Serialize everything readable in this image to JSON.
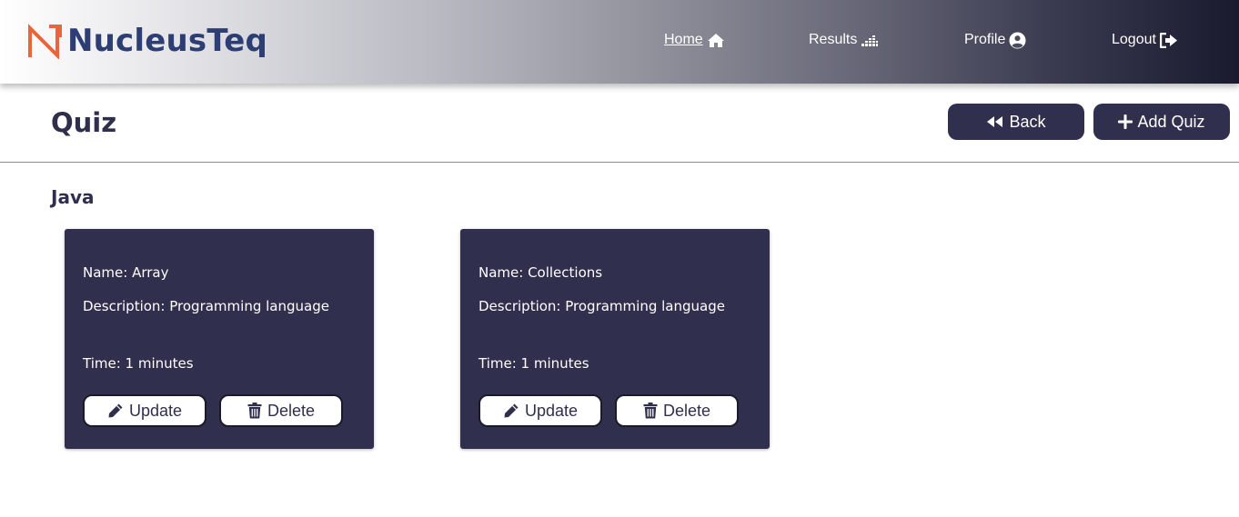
{
  "header": {
    "brand": "NucleusTeq",
    "nav": [
      {
        "label": "Home",
        "icon": "home-icon",
        "active": true
      },
      {
        "label": "Results",
        "icon": "chart-icon",
        "active": false
      },
      {
        "label": "Profile",
        "icon": "user-circle-icon",
        "active": false
      },
      {
        "label": "Logout",
        "icon": "logout-icon",
        "active": false
      }
    ]
  },
  "page": {
    "title": "Quiz",
    "back_label": "Back",
    "add_label": "Add Quiz"
  },
  "section": {
    "title": "Java",
    "cards": [
      {
        "name": "Name: Array",
        "description": "Description: Programming language",
        "time": "Time: 1 minutes",
        "update_label": "Update",
        "delete_label": "Delete"
      },
      {
        "name": "Name: Collections",
        "description": "Description: Programming language",
        "time": "Time: 1 minutes",
        "update_label": "Update",
        "delete_label": "Delete"
      }
    ]
  },
  "colors": {
    "brand_blue": "#2c3e74",
    "brand_orange": "#e8663a",
    "card_bg": "#30304e",
    "header_dark": "#191a2e"
  }
}
